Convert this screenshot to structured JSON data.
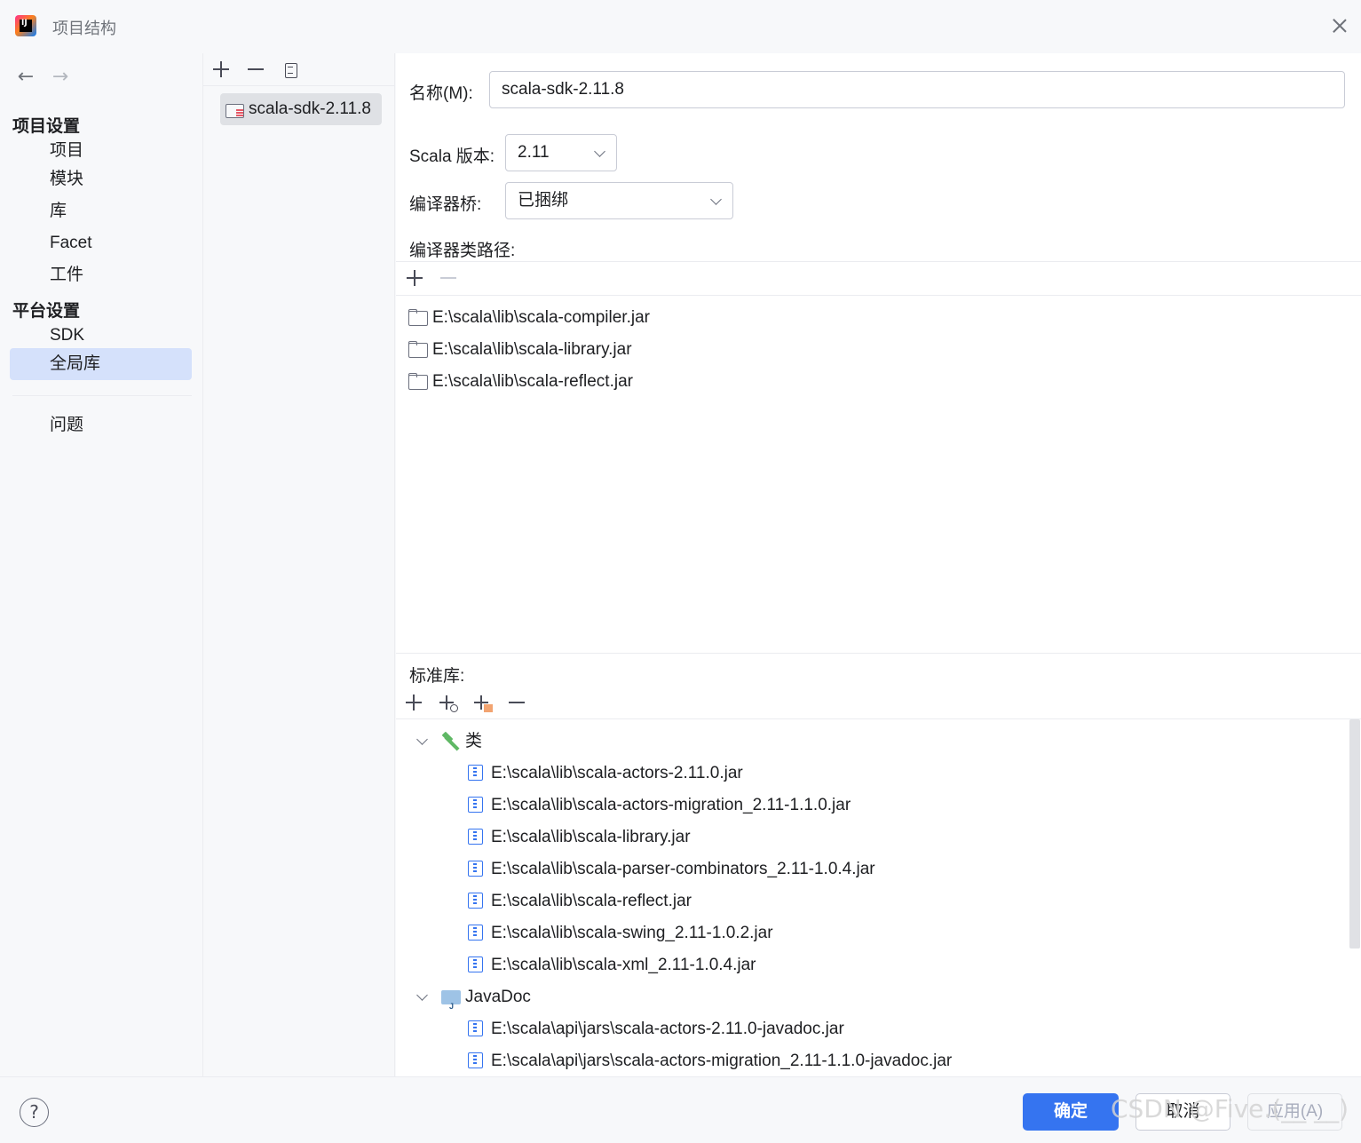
{
  "window": {
    "title": "项目结构"
  },
  "nav": {
    "back_icon": "←",
    "forward_icon": "→",
    "project_settings_header": "项目设置",
    "project_items": [
      "项目",
      "模块",
      "库",
      "Facet",
      "工件"
    ],
    "platform_settings_header": "平台设置",
    "platform_items": [
      "SDK",
      "全局库"
    ],
    "selected": "全局库",
    "problems": "问题"
  },
  "libraries": {
    "items": [
      "scala-sdk-2.11.8"
    ]
  },
  "detail": {
    "name_label": "名称(M):",
    "name_value": "scala-sdk-2.11.8",
    "scala_version_label": "Scala 版本:",
    "scala_version_value": "2.11",
    "compiler_bridge_label": "编译器桥:",
    "compiler_bridge_value": "已捆绑",
    "compiler_classpath_label": "编译器类路径:",
    "compiler_classpath": [
      "E:\\scala\\lib\\scala-compiler.jar",
      "E:\\scala\\lib\\scala-library.jar",
      "E:\\scala\\lib\\scala-reflect.jar"
    ],
    "std_library_label": "标准库:",
    "classes_node": "类",
    "classes": [
      "E:\\scala\\lib\\scala-actors-2.11.0.jar",
      "E:\\scala\\lib\\scala-actors-migration_2.11-1.1.0.jar",
      "E:\\scala\\lib\\scala-library.jar",
      "E:\\scala\\lib\\scala-parser-combinators_2.11-1.0.4.jar",
      "E:\\scala\\lib\\scala-reflect.jar",
      "E:\\scala\\lib\\scala-swing_2.11-1.0.2.jar",
      "E:\\scala\\lib\\scala-xml_2.11-1.0.4.jar"
    ],
    "javadoc_node": "JavaDoc",
    "javadoc": [
      "E:\\scala\\api\\jars\\scala-actors-2.11.0-javadoc.jar",
      "E:\\scala\\api\\jars\\scala-actors-migration_2.11-1.1.0-javadoc.jar"
    ]
  },
  "footer": {
    "help": "?",
    "ok": "确定",
    "cancel": "取消",
    "apply": "应用(A)",
    "watermark": "CSDN @Five.(__ __)"
  },
  "colors": {
    "accent": "#3574f0",
    "selection": "#d5e1fb",
    "background": "#f7f8fa"
  }
}
